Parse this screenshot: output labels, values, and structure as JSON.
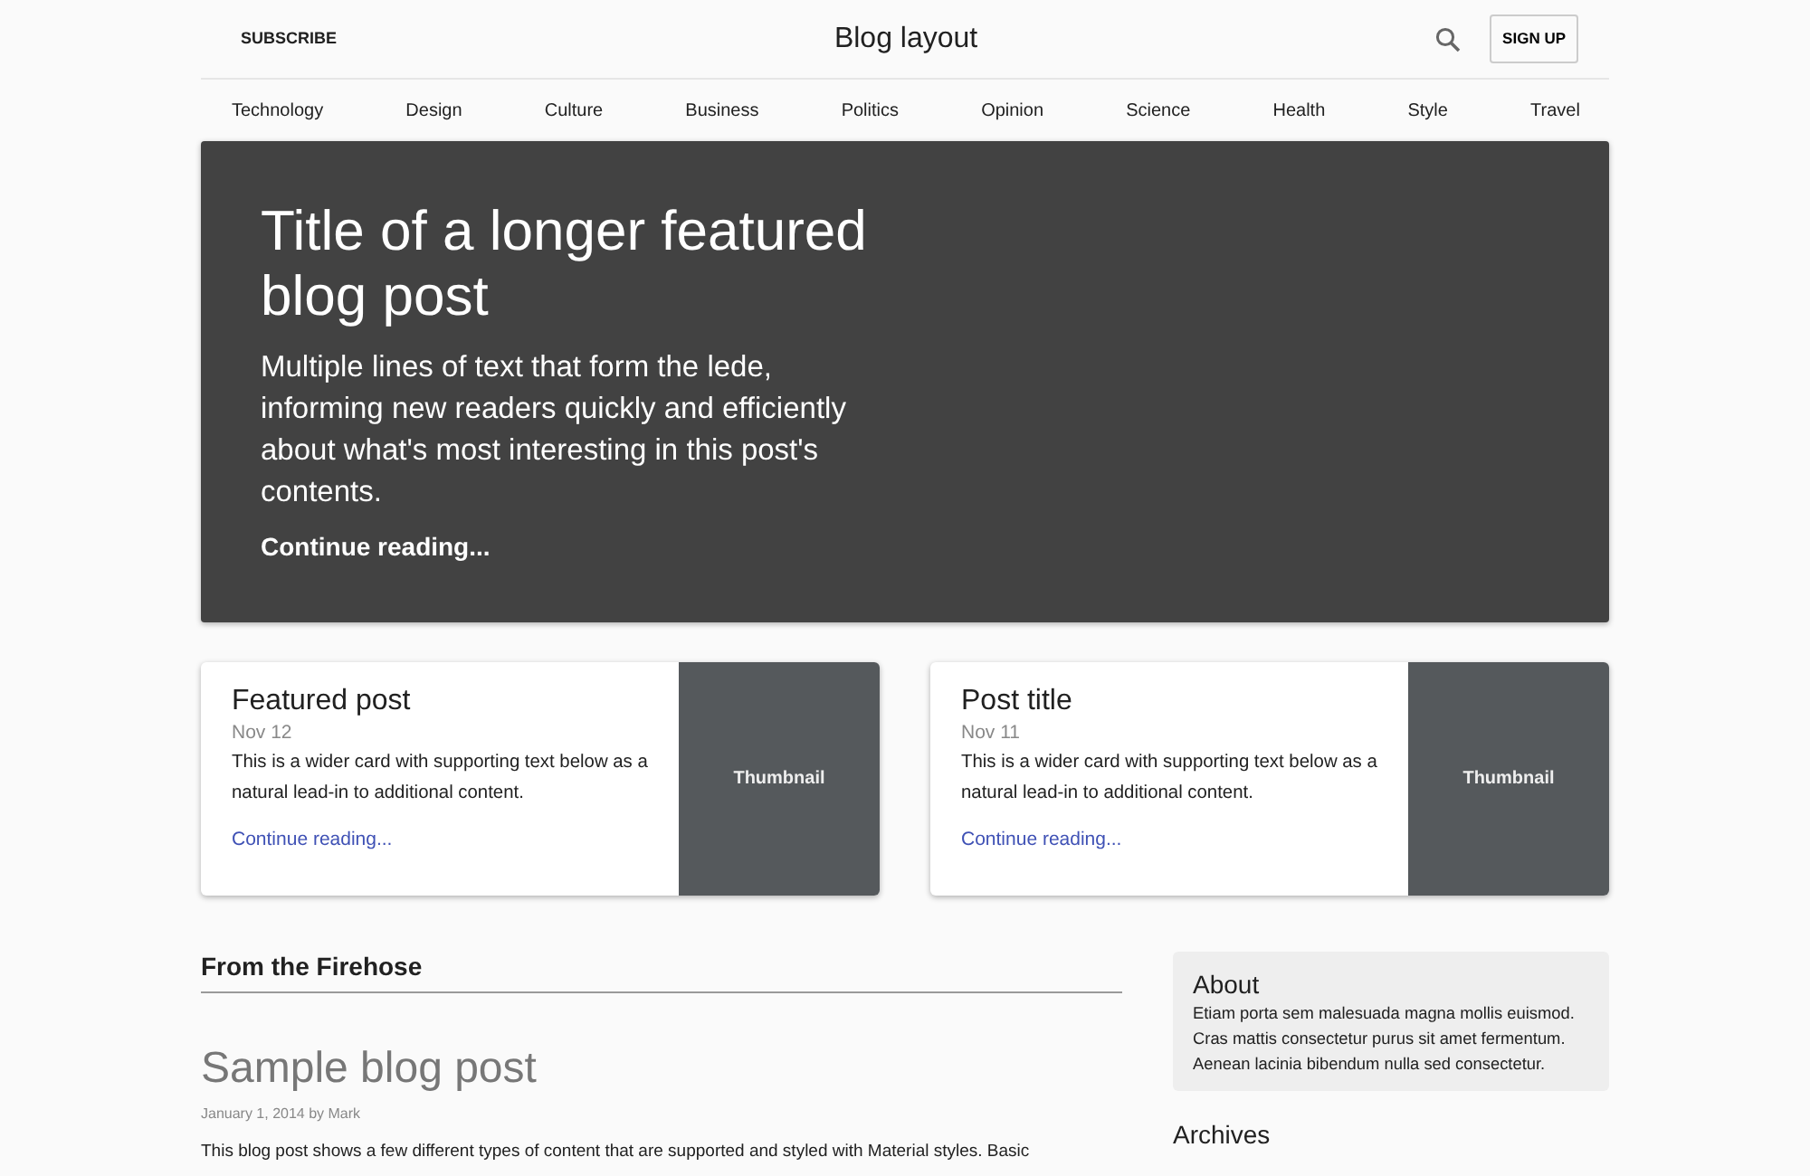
{
  "header": {
    "subscribe": "SUBSCRIBE",
    "title": "Blog layout",
    "signup": "SIGN UP"
  },
  "nav": [
    "Technology",
    "Design",
    "Culture",
    "Business",
    "Politics",
    "Opinion",
    "Science",
    "Health",
    "Style",
    "Travel"
  ],
  "hero": {
    "title": "Title of a longer featured blog post",
    "lede": "Multiple lines of text that form the lede, informing new readers quickly and efficiently about what's most interesting in this post's contents.",
    "link": "Continue reading..."
  },
  "cards": [
    {
      "title": "Featured post",
      "date": "Nov 12",
      "text": "This is a wider card with supporting text below as a natural lead-in to additional content.",
      "link": "Continue reading...",
      "thumbnail": "Thumbnail"
    },
    {
      "title": "Post title",
      "date": "Nov 11",
      "text": "This is a wider card with supporting text below as a natural lead-in to additional content.",
      "link": "Continue reading...",
      "thumbnail": "Thumbnail"
    }
  ],
  "main": {
    "heading": "From the Firehose",
    "post": {
      "title": "Sample blog post",
      "meta": "January 1, 2014 by Mark",
      "text": "This blog post shows a few different types of content that are supported and styled with Material styles. Basic"
    }
  },
  "sidebar": {
    "about": {
      "title": "About",
      "text": "Etiam porta sem malesuada magna mollis euismod. Cras mattis consectetur purus sit amet fermentum. Aenean lacinia bibendum nulla sed consectetur."
    },
    "archives": "Archives"
  }
}
